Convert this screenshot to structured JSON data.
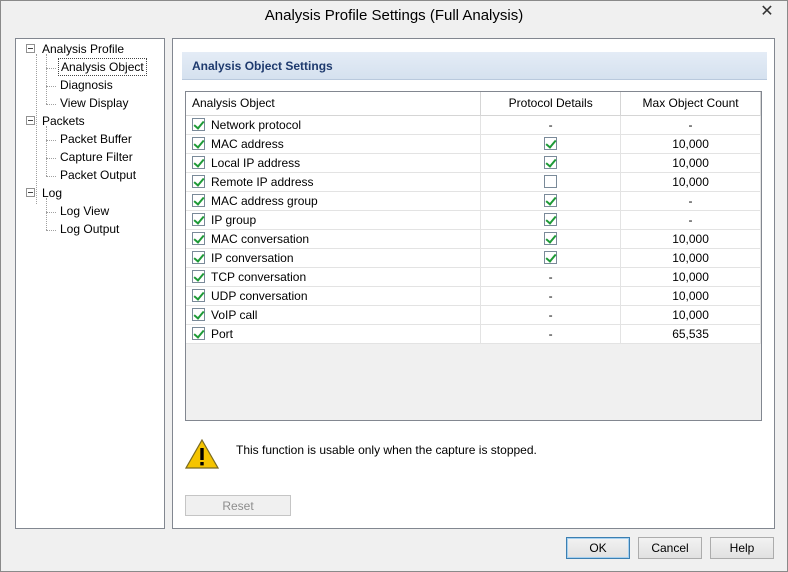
{
  "window": {
    "title": "Analysis Profile Settings (Full Analysis)",
    "close_glyph": "✕"
  },
  "tree": {
    "nodes": [
      {
        "label": "Analysis Profile"
      },
      {
        "label": "Analysis Object"
      },
      {
        "label": "Diagnosis"
      },
      {
        "label": "View Display"
      },
      {
        "label": "Packets"
      },
      {
        "label": "Packet Buffer"
      },
      {
        "label": "Capture Filter"
      },
      {
        "label": "Packet Output"
      },
      {
        "label": "Log"
      },
      {
        "label": "Log View"
      },
      {
        "label": "Log Output"
      }
    ]
  },
  "panel": {
    "header": "Analysis Object Settings",
    "columns": [
      "Analysis Object",
      "Protocol Details",
      "Max Object Count"
    ],
    "rows": [
      {
        "name": "Network protocol",
        "enabled": true,
        "details": "-",
        "count": "-"
      },
      {
        "name": "MAC address",
        "enabled": true,
        "details": "checked",
        "count": "10,000"
      },
      {
        "name": "Local IP address",
        "enabled": true,
        "details": "checked",
        "count": "10,000"
      },
      {
        "name": "Remote IP address",
        "enabled": true,
        "details": "unchecked",
        "count": "10,000"
      },
      {
        "name": "MAC address group",
        "enabled": true,
        "details": "checked",
        "count": "-"
      },
      {
        "name": "IP group",
        "enabled": true,
        "details": "checked",
        "count": "-"
      },
      {
        "name": "MAC conversation",
        "enabled": true,
        "details": "checked",
        "count": "10,000"
      },
      {
        "name": "IP conversation",
        "enabled": true,
        "details": "checked",
        "count": "10,000"
      },
      {
        "name": "TCP conversation",
        "enabled": true,
        "details": "-",
        "count": "10,000"
      },
      {
        "name": "UDP conversation",
        "enabled": true,
        "details": "-",
        "count": "10,000"
      },
      {
        "name": "VoIP call",
        "enabled": true,
        "details": "-",
        "count": "10,000"
      },
      {
        "name": "Port",
        "enabled": true,
        "details": "-",
        "count": "65,535"
      }
    ],
    "warning": "This function is usable only when the capture is stopped.",
    "reset_label": "Reset"
  },
  "buttons": {
    "ok": "OK",
    "cancel": "Cancel",
    "help": "Help"
  },
  "colors": {
    "check": "#1e9a37",
    "header_text": "#1e3a6e",
    "warning_yellow": "#f5c400"
  }
}
